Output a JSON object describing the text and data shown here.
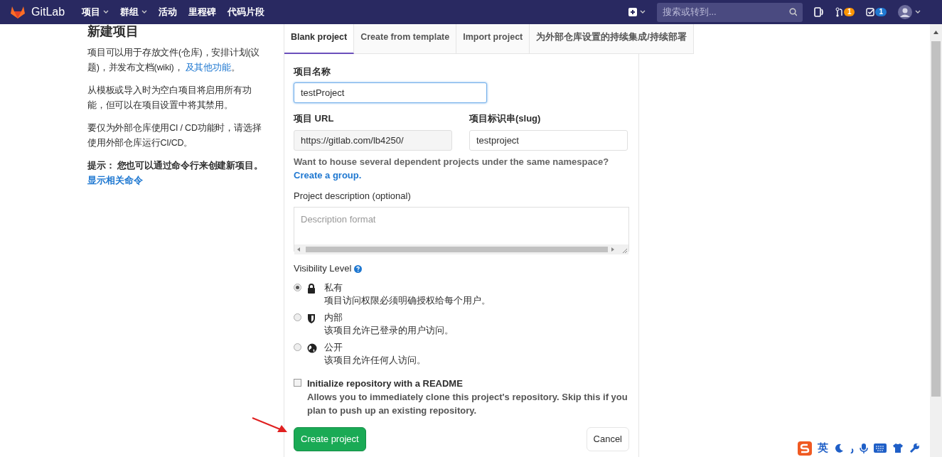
{
  "navbar": {
    "brand": "GitLab",
    "menu": [
      {
        "label": "项目",
        "dropdown": true
      },
      {
        "label": "群组",
        "dropdown": true
      },
      {
        "label": "活动",
        "dropdown": false
      },
      {
        "label": "里程碑",
        "dropdown": false
      },
      {
        "label": "代码片段",
        "dropdown": false
      }
    ],
    "search": {
      "placeholder": "搜索或转到..."
    },
    "merge_requests_count": "1",
    "todos_count": "1"
  },
  "sidebar": {
    "title": "新建项目",
    "paragraphs": [
      {
        "bold": false,
        "parts": [
          {
            "text": "项目可以用于存放文件(仓库)，安排计划(议题)，并发布文档(wiki)， ",
            "link": false
          },
          {
            "text": "及其他功能",
            "link": true
          },
          {
            "text": "。",
            "link": false
          }
        ]
      },
      {
        "bold": false,
        "parts": [
          {
            "text": "从模板或导入时为空白项目将启用所有功能，但可以在项目设置中将其禁用。",
            "link": false
          }
        ]
      },
      {
        "bold": false,
        "parts": [
          {
            "text": "要仅为外部仓库使用CI / CD功能时，请选择使用外部仓库运行CI/CD。",
            "link": false
          }
        ]
      },
      {
        "bold": true,
        "parts": [
          {
            "text": "提示： 您也可以通过命令行来创建新项目。",
            "link": false
          }
        ]
      }
    ],
    "command_link": "显示相关命令"
  },
  "tabs": [
    {
      "label": "Blank project",
      "selected": true
    },
    {
      "label": "Create from template",
      "selected": false
    },
    {
      "label": "Import project",
      "selected": false
    },
    {
      "label": "为外部仓库设置的持续集成/持续部署",
      "selected": false
    }
  ],
  "form": {
    "name_label": "项目名称",
    "name_value": "testProject",
    "url_label": "项目 URL",
    "url_value": "https://gitlab.com/lb4250/",
    "slug_label": "项目标识串(slug)",
    "slug_value": "testproject",
    "group_hint": "Want to house several dependent projects under the same namespace?",
    "group_link": "Create a group.",
    "description_label": "Project description (optional)",
    "description_placeholder": "Description format",
    "visibility_label": "Visibility Level",
    "visibility": [
      {
        "kind": "lock",
        "title": "私有",
        "description": "项目访问权限必须明确授权给每个用户。",
        "selected": true
      },
      {
        "kind": "shield",
        "title": "内部",
        "description": "该项目允许已登录的用户访问。",
        "selected": false
      },
      {
        "kind": "globe",
        "title": "公开",
        "description": "该项目允许任何人访问。",
        "selected": false
      }
    ],
    "readme": {
      "label": "Initialize repository with a README",
      "description": "Allows you to immediately clone this project's repository. Skip this if you plan to push up an existing repository.",
      "checked": false
    },
    "submit": "Create project",
    "cancel": "Cancel"
  },
  "ime_toolbar": {
    "mode": "英"
  }
}
